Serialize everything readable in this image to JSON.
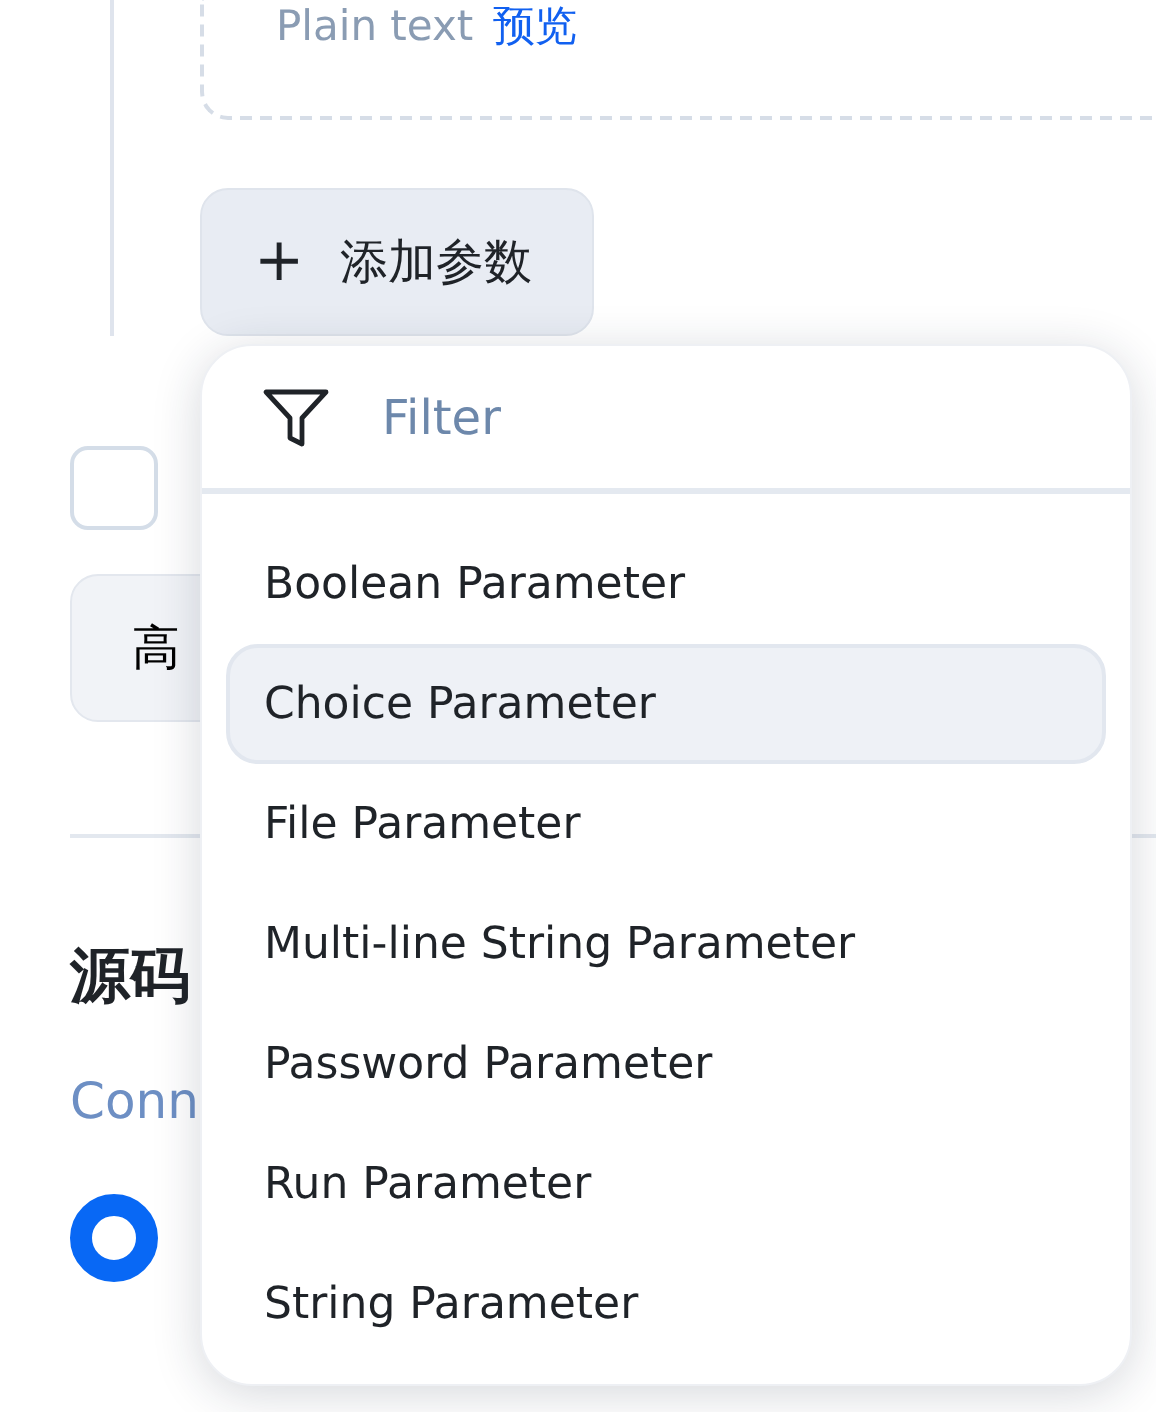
{
  "preview": {
    "format": "Plain text",
    "link": "预览"
  },
  "add_button": {
    "icon": "+",
    "label": "添加参数"
  },
  "option_checkbox": {
    "checked": false
  },
  "advanced_button": {
    "label": "高"
  },
  "section": {
    "title": "源码",
    "description": "Conn"
  },
  "source_radio": {
    "selected": true
  },
  "dropdown": {
    "filter_placeholder": "Filter",
    "items": [
      {
        "label": "Boolean Parameter",
        "selected": false
      },
      {
        "label": "Choice Parameter",
        "selected": true
      },
      {
        "label": "File Parameter",
        "selected": false
      },
      {
        "label": "Multi-line String Parameter",
        "selected": false
      },
      {
        "label": "Password Parameter",
        "selected": false
      },
      {
        "label": "Run Parameter",
        "selected": false
      },
      {
        "label": "String Parameter",
        "selected": false
      }
    ]
  }
}
